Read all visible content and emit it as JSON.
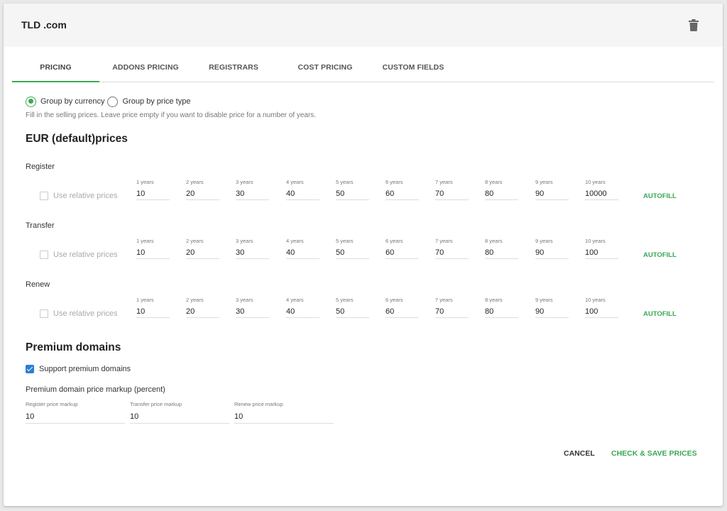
{
  "header": {
    "title": "TLD .com",
    "delete_icon": "trash-icon"
  },
  "tabs": [
    {
      "label": "PRICING",
      "active": true
    },
    {
      "label": "ADDONS PRICING",
      "active": false
    },
    {
      "label": "REGISTRARS",
      "active": false
    },
    {
      "label": "COST PRICING",
      "active": false
    },
    {
      "label": "CUSTOM FIELDS",
      "active": false
    }
  ],
  "grouping": {
    "by_currency": "Group by currency",
    "by_price_type": "Group by price type",
    "selected": "by_currency"
  },
  "hint": "Fill in the selling prices. Leave price empty if you want to disable price for a number of years.",
  "currency_heading": "EUR (default)prices",
  "relative_label": "Use relative prices",
  "autofill_label": "AUTOFILL",
  "year_labels": [
    "1 years",
    "2 years",
    "3 years",
    "4 years",
    "5 years",
    "6 years",
    "7 years",
    "8 years",
    "9 years",
    "10 years"
  ],
  "price_rows": [
    {
      "label": "Register",
      "values": [
        "10",
        "20",
        "30",
        "40",
        "50",
        "60",
        "70",
        "80",
        "90",
        "10000"
      ]
    },
    {
      "label": "Transfer",
      "values": [
        "10",
        "20",
        "30",
        "40",
        "50",
        "60",
        "70",
        "80",
        "90",
        "100"
      ]
    },
    {
      "label": "Renew",
      "values": [
        "10",
        "20",
        "30",
        "40",
        "50",
        "60",
        "70",
        "80",
        "90",
        "100"
      ]
    }
  ],
  "premium": {
    "heading": "Premium domains",
    "support_label": "Support premium domains",
    "support_checked": true,
    "markup_title": "Premium domain price markup (percent)",
    "fields": [
      {
        "label": "Register price markup",
        "value": "10"
      },
      {
        "label": "Transfer price markup",
        "value": "10"
      },
      {
        "label": "Renew price markup",
        "value": "10"
      }
    ]
  },
  "actions": {
    "cancel": "CANCEL",
    "save": "CHECK & SAVE PRICES"
  },
  "colors": {
    "accent": "#3aa855",
    "checkbox": "#2a7fd4"
  }
}
